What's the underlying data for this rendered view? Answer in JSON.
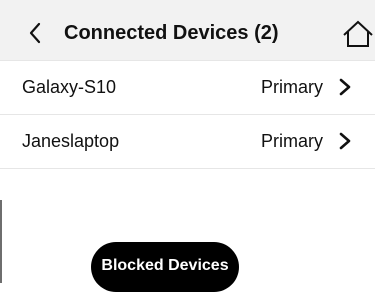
{
  "header": {
    "title": "Connected Devices (2)",
    "back_icon": "chevron-left-icon",
    "home_icon": "home-icon"
  },
  "devices": [
    {
      "name": "Galaxy-S10",
      "status": "Primary",
      "icon": "chevron-right-icon"
    },
    {
      "name": "Janeslaptop",
      "status": "Primary",
      "icon": "chevron-right-icon"
    }
  ],
  "blocked_devices_button": {
    "label": "Blocked Devices",
    "color": "#000000"
  }
}
